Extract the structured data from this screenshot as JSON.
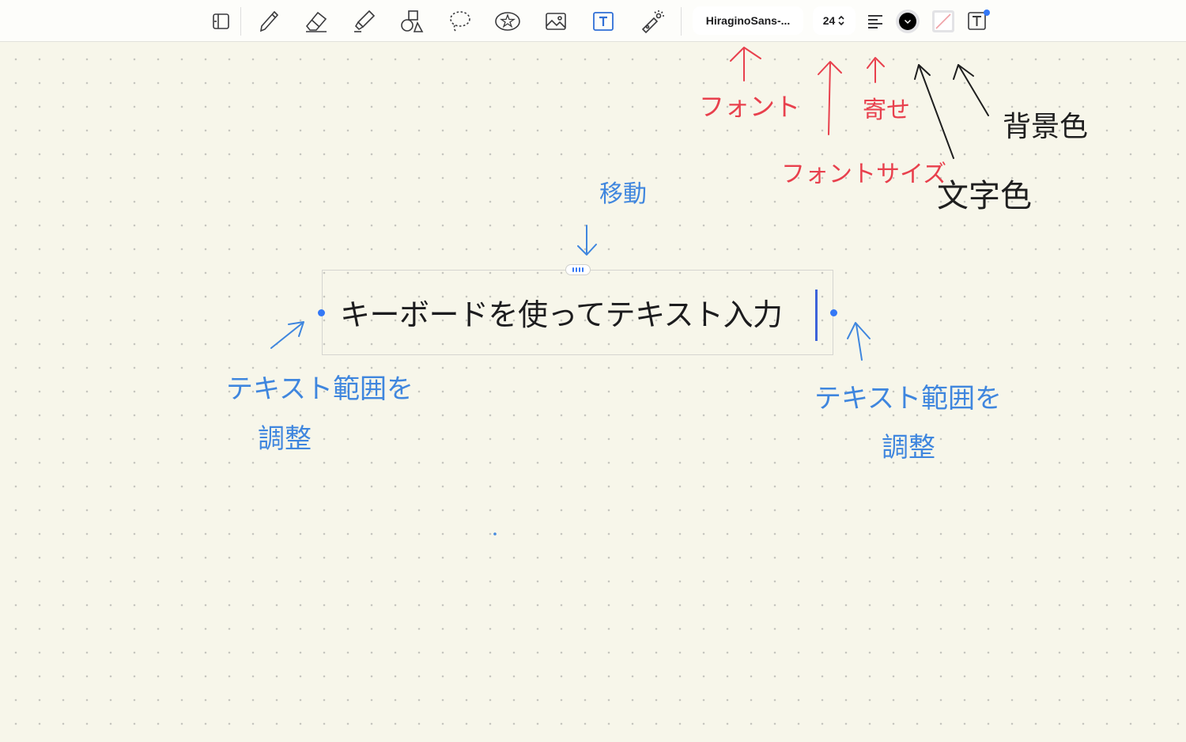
{
  "toolbar": {
    "tools": [
      {
        "name": "sidebar-toggle-icon"
      },
      {
        "name": "pen-icon"
      },
      {
        "name": "eraser-icon"
      },
      {
        "name": "highlighter-icon"
      },
      {
        "name": "shapes-icon"
      },
      {
        "name": "lasso-icon"
      },
      {
        "name": "sticker-icon"
      },
      {
        "name": "image-icon"
      },
      {
        "name": "text-tool-icon",
        "active": true
      },
      {
        "name": "laser-pointer-icon"
      }
    ],
    "font_name": "HiraginoSans-...",
    "font_size": "24",
    "text_color": "#000000",
    "accent": "#3478f6"
  },
  "canvas": {
    "text_box_content": "キーボードを使ってテキスト入力"
  },
  "annotations": {
    "font": "フォント",
    "font_size": "フォントサイズ",
    "align": "寄せ",
    "text_color": "文字色",
    "background_color": "背景色",
    "move": "移動",
    "adjust_left_line1": "テキスト範囲を",
    "adjust_left_line2": "調整",
    "adjust_right_line1": "テキスト範囲を",
    "adjust_right_line2": "調整"
  },
  "colors": {
    "paper": "#f7f6ea",
    "red_ink": "#e8404d",
    "blue_ink": "#3f86de",
    "black_ink": "#1f1f1f"
  }
}
